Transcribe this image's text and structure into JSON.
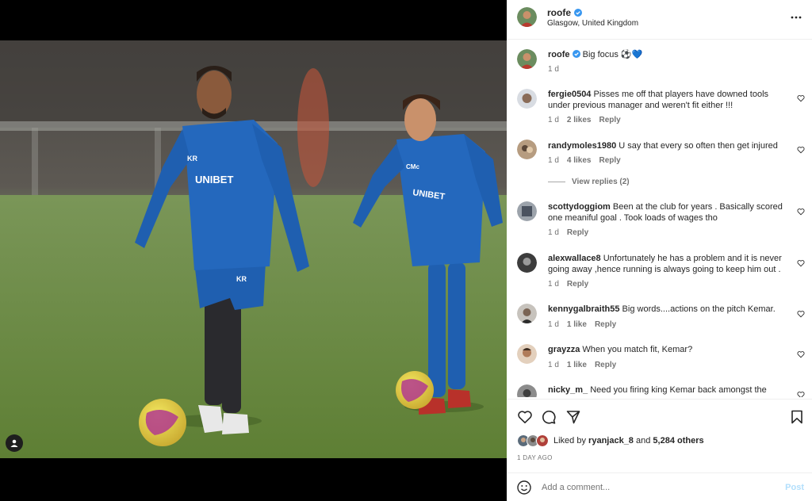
{
  "post": {
    "username": "roofe",
    "location": "Glasgow, United Kingdom",
    "caption": "Big focus ⚽💙",
    "caption_time": "1 d"
  },
  "comments": [
    {
      "username": "fergie0504",
      "text": "Pisses me off that players have downed tools under previous manager and weren't fit either !!!",
      "time": "1 d",
      "likes": "2 likes",
      "reply": "Reply"
    },
    {
      "username": "randymoles1980",
      "text": "U say that every so often then get injured",
      "time": "1 d",
      "likes": "4 likes",
      "reply": "Reply"
    },
    {
      "username": "scottydoggiom",
      "text": "Been at the club for years . Basically scored one meaniful goal . Took loads of wages tho",
      "time": "1 d",
      "likes": "",
      "reply": "Reply"
    },
    {
      "username": "alexwallace8",
      "text": "Unfortunately he has a problem and it is never going away ,hence running is always going to keep him out .",
      "time": "1 d",
      "likes": "",
      "reply": "Reply"
    },
    {
      "username": "kennygalbraith55",
      "text": "Big words....actions on the pitch Kemar.",
      "time": "1 d",
      "likes": "1 like",
      "reply": "Reply"
    },
    {
      "username": "grayzza",
      "text": "When you match fit, Kemar?",
      "time": "1 d",
      "likes": "1 like",
      "reply": "Reply"
    },
    {
      "username": "nicky_m_",
      "text": "Need you firing king Kemar back amongst the",
      "time": "",
      "likes": "",
      "reply": ""
    }
  ],
  "view_replies": "View replies (2)",
  "likes": {
    "prefix": "Liked by",
    "user": "ryanjack_8",
    "and": "and",
    "others": "5,284 others"
  },
  "timestamp": "1 DAY AGO",
  "add_comment": {
    "placeholder": "Add a comment...",
    "post_label": "Post"
  },
  "photo_text": {
    "sponsor": "UNIBET",
    "initials_left": "KR",
    "initials_right": "CMc"
  },
  "colors": {
    "verified": "#3897f0",
    "kit_blue": "#1f5fb0",
    "post_disabled": "#b2dffc",
    "meta_grey": "#737373"
  },
  "icons": [
    "verified-icon",
    "more-options-icon",
    "heart-icon",
    "comment-icon",
    "share-icon",
    "bookmark-icon",
    "emoji-icon",
    "tagged-user-icon"
  ]
}
